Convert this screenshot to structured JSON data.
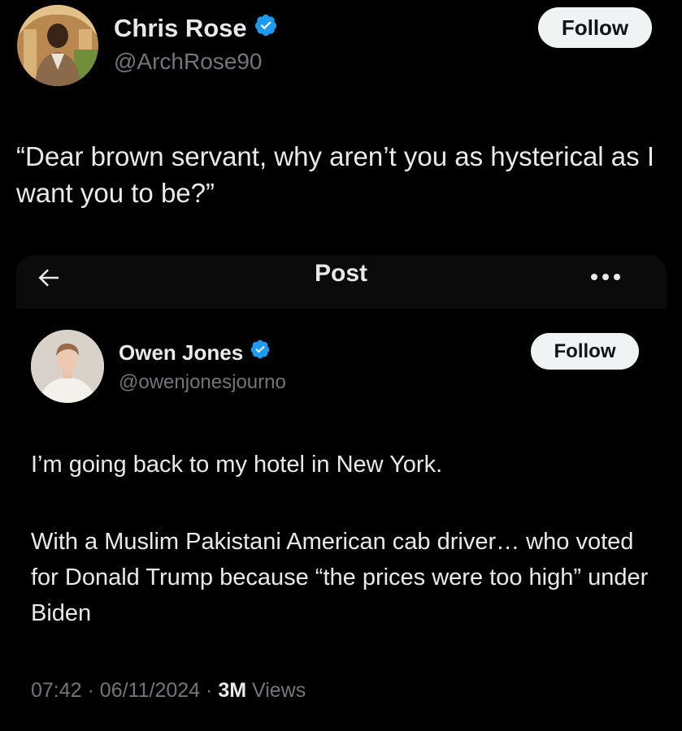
{
  "outer_tweet": {
    "author": {
      "name": "Chris Rose",
      "handle": "@ArchRose90",
      "verified": true
    },
    "follow_label": "Follow",
    "text": "“Dear brown servant, why aren’t you as hysterical as I want you to be?”"
  },
  "quoted_post": {
    "header": {
      "back_icon": "arrow-left-icon",
      "title": "Post",
      "more_icon": "more-horizontal-icon"
    },
    "author": {
      "name": "Owen Jones",
      "handle": "@owenjonesjourno",
      "verified": true
    },
    "follow_label": "Follow",
    "paragraphs": [
      "I’m going back to my hotel in New York.",
      "With a Muslim Pakistani American cab driver… who voted for Donald Trump because “the prices were too high” under Biden"
    ],
    "meta": {
      "time": "07:42",
      "separator": "·",
      "date": "06/11/2024",
      "views_count": "3M",
      "views_label": "Views"
    }
  },
  "colors": {
    "background": "#000000",
    "text_primary": "#e7e9ea",
    "text_secondary": "#71767b",
    "verified_blue": "#1d9bf0",
    "follow_bg": "#eff3f4",
    "follow_text": "#0f1419"
  }
}
